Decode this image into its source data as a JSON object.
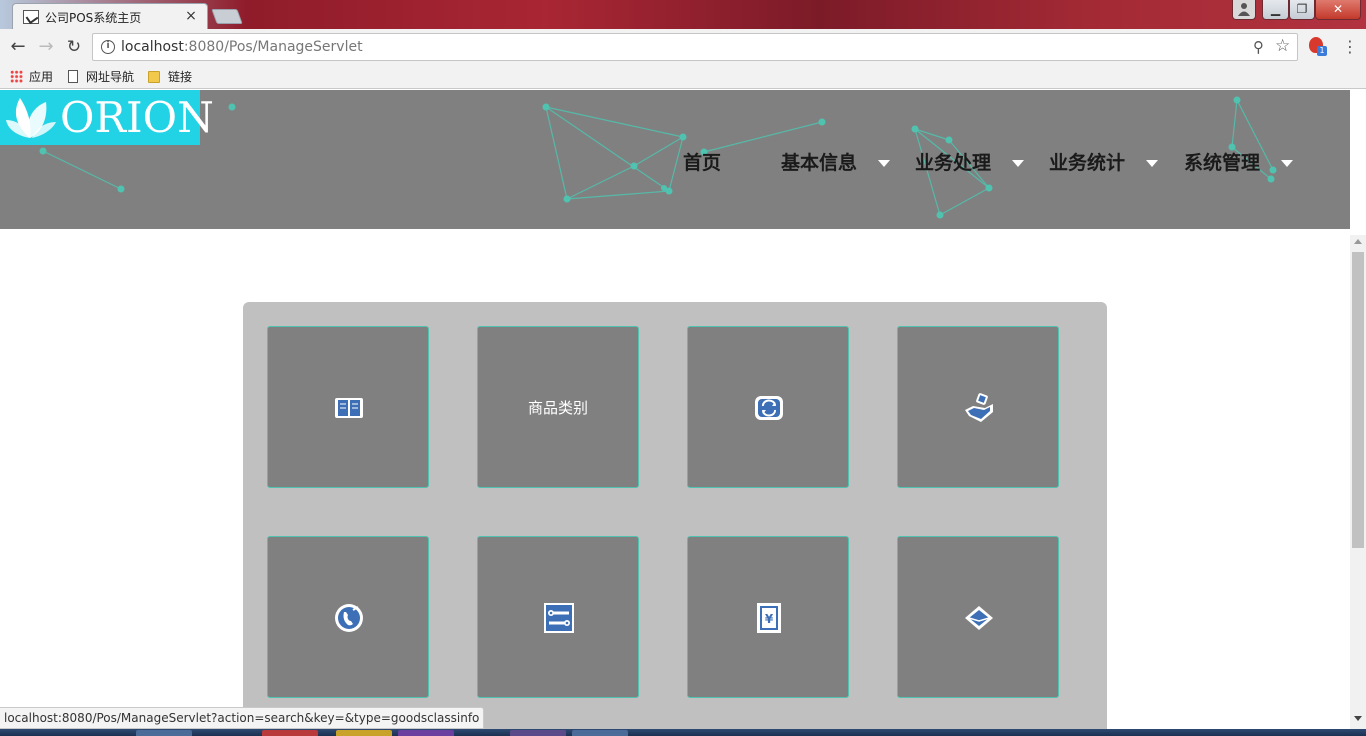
{
  "browser": {
    "tab_title": "公司POS系统主页",
    "tab_close": "×",
    "url_host": "localhost",
    "url_rest": ":8080/Pos/ManageServlet",
    "ext_badge": "1",
    "window_min": "▁",
    "window_max": "❐",
    "window_close": "✕"
  },
  "bookmarks": {
    "apps": "应用",
    "nav_site": "网址导航",
    "links": "链接"
  },
  "site": {
    "logo_text": "ORION",
    "nav": {
      "home": "首页",
      "basic_info": "基本信息",
      "business": "业务处理",
      "stats": "业务统计",
      "system": "系统管理"
    },
    "accent_color": "#4fc3b0",
    "header_color": "#808080"
  },
  "tiles": [
    {
      "icon": "book-icon",
      "label": ""
    },
    {
      "icon": "",
      "label": "商品类别"
    },
    {
      "icon": "refresh-icon",
      "label": ""
    },
    {
      "icon": "hand-coin-icon",
      "label": ""
    },
    {
      "icon": "phone-icon",
      "label": ""
    },
    {
      "icon": "tools-icon",
      "label": ""
    },
    {
      "icon": "yen-document-icon",
      "label": ""
    },
    {
      "icon": "mail-icon",
      "label": ""
    }
  ],
  "status_url": "localhost:8080/Pos/ManageServlet?action=search&key=&type=goodsclassinfo"
}
